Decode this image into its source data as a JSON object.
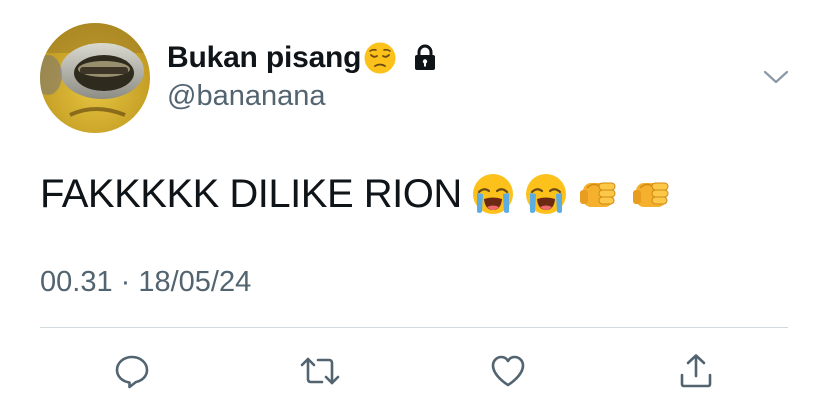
{
  "tweet": {
    "display_name": "Bukan pisang",
    "name_emoji": "pensive-face-emoji",
    "protected_icon": "lock-icon",
    "handle": "@bananana",
    "text": "FAKKKKK DILIKE RION",
    "text_emojis": [
      "loudly-crying-face-emoji",
      "loudly-crying-face-emoji",
      "oncoming-fist-emoji",
      "oncoming-fist-emoji"
    ],
    "timestamp": "00.31 · 18/05/24"
  },
  "actions": [
    {
      "icon": "reply-icon"
    },
    {
      "icon": "retweet-icon"
    },
    {
      "icon": "like-icon"
    },
    {
      "icon": "share-icon"
    }
  ],
  "colors": {
    "text_primary": "#0f1419",
    "text_secondary": "#536471",
    "divider": "#cfd9de",
    "icon": "#536471"
  }
}
